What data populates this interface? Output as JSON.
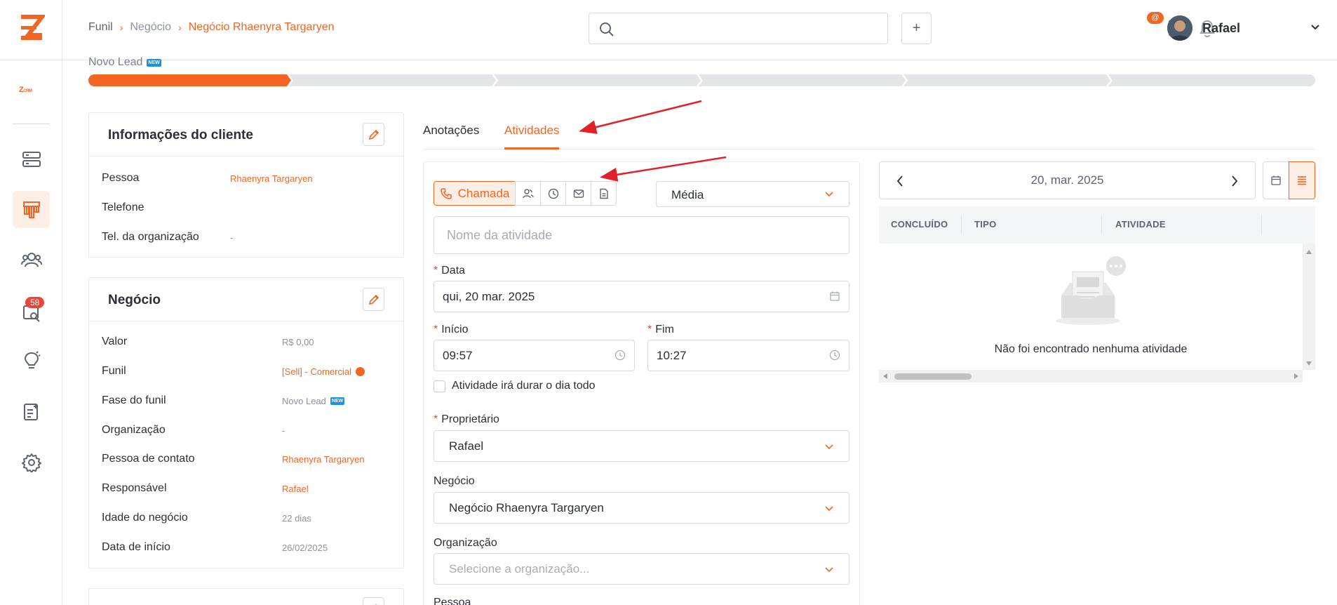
{
  "topbar": {
    "breadcrumb": [
      "Funil",
      "Negócio",
      "Negócio Rhaenyra Targaryen"
    ],
    "search_placeholder": "",
    "plus_label": "+",
    "notification_count": "@",
    "user_name": "Rafael"
  },
  "sidebar": {
    "crm_logo": "Z",
    "crm_logo_small": "CRM",
    "badge_count": "58",
    "items": [
      "pipeline-icon",
      "funnel-icon",
      "users-icon",
      "search-inbox-icon",
      "lightbulb-icon",
      "notes-icon",
      "gear-icon"
    ]
  },
  "stage": {
    "label": "Novo Lead",
    "tag": "NEW",
    "progress_filled_segments": 1,
    "total_segments": 6
  },
  "client_card": {
    "title": "Informações do cliente",
    "rows": [
      {
        "label": "Pessoa",
        "value": "Rhaenyra Targaryen"
      },
      {
        "label": "Telefone",
        "value": ""
      },
      {
        "label": "Tel. da organização",
        "value": "-"
      }
    ]
  },
  "deal_card": {
    "title": "Negócio",
    "rows": [
      {
        "label": "Valor",
        "value": "R$ 0,00"
      },
      {
        "label": "Funil",
        "value": "[Sell] - Comercial"
      },
      {
        "label": "Fase do funil",
        "value": "Novo Lead"
      },
      {
        "label": "Organização",
        "value": "-"
      },
      {
        "label": "Pessoa de contato",
        "value": "Rhaenyra Targaryen"
      },
      {
        "label": "Responsável",
        "value": "Rafael"
      },
      {
        "label": "Idade do negócio",
        "value": "22 dias"
      },
      {
        "label": "Data de início",
        "value": "26/02/2025"
      }
    ]
  },
  "tabs": [
    "Anotações",
    "Atividades"
  ],
  "form": {
    "type_active": "Chamada",
    "priority": "Média",
    "name_placeholder": "Nome da atividade",
    "date_label": "Data",
    "date_value": "qui, 20 mar. 2025",
    "start_label": "Início",
    "start_value": "09:57",
    "end_label": "Fim",
    "end_value": "10:27",
    "all_day_label": "Atividade irá durar o dia todo",
    "owner_label": "Proprietário",
    "owner_value": "Rafael",
    "deal_label": "Negócio",
    "deal_value": "Negócio Rhaenyra Targaryen",
    "org_label": "Organização",
    "org_placeholder": "Selecione a organização...",
    "person_label": "Pessoa"
  },
  "calendar": {
    "date": "20, mar. 2025",
    "columns": [
      "CONCLUÍDO",
      "TIPO",
      "ATIVIDADE"
    ],
    "empty_text": "Não foi encontrado nenhuma atividade"
  },
  "colors": {
    "accent": "#f26522",
    "accent_soft": "#fdeee6",
    "segment_empty": "#e3e5e8",
    "annotation_arrow": "#e2202a"
  }
}
